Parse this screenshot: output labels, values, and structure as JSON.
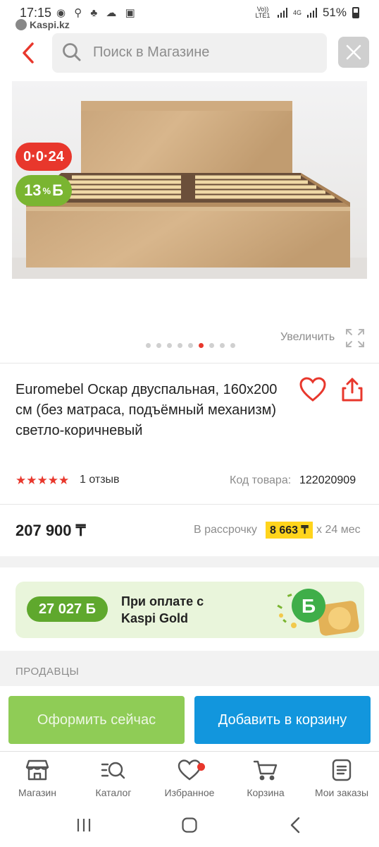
{
  "status_bar": {
    "time": "17:15",
    "left_icons": "◉ ⚲ ♣ ☁ ▣",
    "app_label": "Kaspi.kz",
    "volte": "Vo)) LTE1",
    "network": "4G",
    "battery": "51%"
  },
  "header": {
    "search_placeholder": "Поиск в Магазине"
  },
  "gallery": {
    "badge_installment": "0·0·24",
    "badge_bonus": "13",
    "badge_bonus_pct": "%",
    "badge_bonus_sign": "Б",
    "zoom_label": "Увеличить",
    "dot_count": 9,
    "active_dot": 5
  },
  "product": {
    "title": "Euromebel Оскар двуспальная, 160х200 см (без матраса, подъёмный механизм) светло-коричневый",
    "rating_stars": "★★★★★",
    "reviews": "1 отзыв",
    "code_label": "Код товара:",
    "code_value": "122020909",
    "price": "207 900 ₸",
    "installment_label": "В рассрочку",
    "installment_value": "8 663 ₸",
    "installment_term": "х 24 мес"
  },
  "kaspi_gold": {
    "bonus": "27 027 Б",
    "text_line1": "При оплате с",
    "text_line2": "Kaspi Gold",
    "art_sign": "Б"
  },
  "sellers": {
    "heading": "ПРОДАВЦЫ"
  },
  "actions": {
    "buy_now": "Оформить сейчас",
    "add_to_cart": "Добавить в корзину"
  },
  "bottom_nav": [
    {
      "label": "Магазин",
      "icon": "store-icon"
    },
    {
      "label": "Каталог",
      "icon": "catalog-icon"
    },
    {
      "label": "Избранное",
      "icon": "heart-icon"
    },
    {
      "label": "Корзина",
      "icon": "cart-icon"
    },
    {
      "label": "Мои заказы",
      "icon": "orders-icon"
    }
  ],
  "colors": {
    "accent_red": "#e8372c",
    "green": "#7ab531",
    "button_green": "#8fcc56",
    "button_blue": "#1296dd",
    "installment_yellow": "#ffd41c"
  }
}
